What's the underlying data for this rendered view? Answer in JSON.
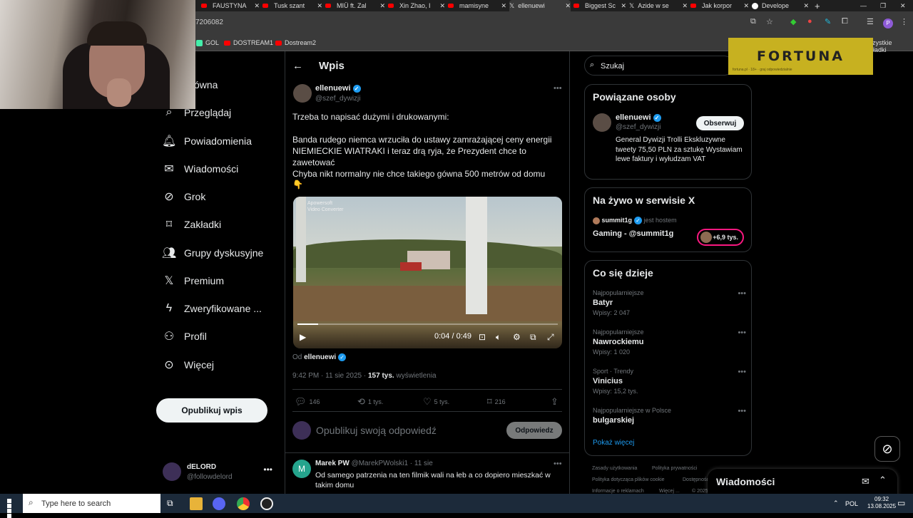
{
  "browser": {
    "tabs": [
      {
        "label": "FAUSTYNA",
        "kind": "youtube"
      },
      {
        "label": "Tusk szant",
        "kind": "youtube"
      },
      {
        "label": "MIÜ ft. Zal",
        "kind": "youtube"
      },
      {
        "label": "Xin Zhao, I",
        "kind": "youtube"
      },
      {
        "label": "mamisyne",
        "kind": "youtube"
      },
      {
        "label": "ellenuewi",
        "kind": "x",
        "active": true
      },
      {
        "label": "Biggest Sc",
        "kind": "youtube"
      },
      {
        "label": "Azide w se",
        "kind": "x"
      },
      {
        "label": "Jak korpor",
        "kind": "youtube"
      },
      {
        "label": "Develope",
        "kind": "github"
      }
    ],
    "url_fragment": "7206082",
    "bookmarks": [
      "GOL",
      "DOSTREAM1",
      "Dostream2"
    ],
    "bookmarks_all": "Wszystkie zakładki"
  },
  "overlay": {
    "fortuna": "FORTUNA",
    "fortuna_small": "fortuna.pl · 18+ · graj odpowiedzialnie"
  },
  "sidebar": {
    "items": [
      {
        "label": "Główna",
        "icon": "home-icon"
      },
      {
        "label": "Przeglądaj",
        "icon": "search-icon"
      },
      {
        "label": "Powiadomienia",
        "icon": "bell-icon"
      },
      {
        "label": "Wiadomości",
        "icon": "mail-icon"
      },
      {
        "label": "Grok",
        "icon": "grok-icon"
      },
      {
        "label": "Zakładki",
        "icon": "bookmark-icon"
      },
      {
        "label": "Grupy dyskusyjne",
        "icon": "people-icon"
      },
      {
        "label": "Premium",
        "icon": "x-logo-icon"
      },
      {
        "label": "Zweryfikowane ...",
        "icon": "lightning-icon"
      },
      {
        "label": "Profil",
        "icon": "person-icon"
      },
      {
        "label": "Więcej",
        "icon": "more-circle-icon"
      }
    ],
    "post_button": "Opublikuj wpis",
    "account": {
      "name": "dELORD",
      "handle": "@followdelord"
    }
  },
  "post": {
    "header": "Wpis",
    "author_name": "ellenuewi",
    "author_handle": "@szef_dywizji",
    "text1": "Trzeba to napisać dużymi i drukowanymi:",
    "text2": "Banda rudego niemca wrzuciła do ustawy zamrażającej ceny energii NIEMIECKIE WIATRAKI i teraz drą ryja, że Prezydent chce to zawetować",
    "text3": "Chyba nikt normalny nie chce takiego gówna 500 metrów od domu",
    "emoji": "👇",
    "video_watermark1": "Apowersoft",
    "video_watermark2": "Video Converter",
    "video_time": "0:04 / 0:49",
    "video_progress": 0.08,
    "from_label": "Od",
    "from_name": "ellenuewi",
    "timestamp": "9:42 PM · 11 sie 2025 · ",
    "views": "157 tys.",
    "views_label": " wyświetlenia",
    "replies": "146",
    "reposts": "1 tys.",
    "likes": "5 tys.",
    "bookmarks": "216",
    "reply_placeholder": "Opublikuj swoją odpowiedź",
    "reply_button": "Odpowiedz"
  },
  "reply": {
    "initial": "M",
    "name": "Marek PW",
    "handle": "@MarekPWolski1 · 11 sie",
    "text": "Od samego patrzenia na ten filmik wali na łeb a co dopiero mieszkać w takim domu"
  },
  "right": {
    "search_placeholder": "Szukaj",
    "related_title": "Powiązane osoby",
    "related": {
      "name": "ellenuewi",
      "handle": "@szef_dywizji",
      "follow": "Obserwuj",
      "bio": "General Dywizji Trolli Ekskluzywne tweety 75,50 PLN za sztukę Wystawiam lewe faktury i wyłudzam VAT"
    },
    "live_title": "Na żywo w serwisie X",
    "live": {
      "host": "summit1g",
      "host_suffix": "jest hostem",
      "title": "Gaming - @summit1g",
      "count": "+6,9 tys."
    },
    "trends_title": "Co się dzieje",
    "trends": [
      {
        "context": "Najpopularniejsze",
        "title": "Batyr",
        "count": "Wpisy: 2 047"
      },
      {
        "context": "Najpopularniejsze",
        "title": "Nawrockiemu",
        "count": "Wpisy: 1 020"
      },
      {
        "context": "Sport · Trendy",
        "title": "Vinicius",
        "count": "Wpisy: 15,2 tys."
      },
      {
        "context": "Najpopularniejsze w Polsce",
        "title": "bulgarskiej",
        "count": ""
      }
    ],
    "show_more": "Pokaż więcej",
    "footer": [
      "Zasady użytkowania",
      "Polityka prywatności",
      "Polityka dotycząca plików cookie",
      "Dostępność",
      "Informacje o reklamach",
      "Więcej ...",
      "© 2025"
    ],
    "messages": "Wiadomości"
  },
  "taskbar": {
    "search": "Type here to search",
    "lang": "POL",
    "time": "09:32",
    "date": "13.08.2025"
  }
}
